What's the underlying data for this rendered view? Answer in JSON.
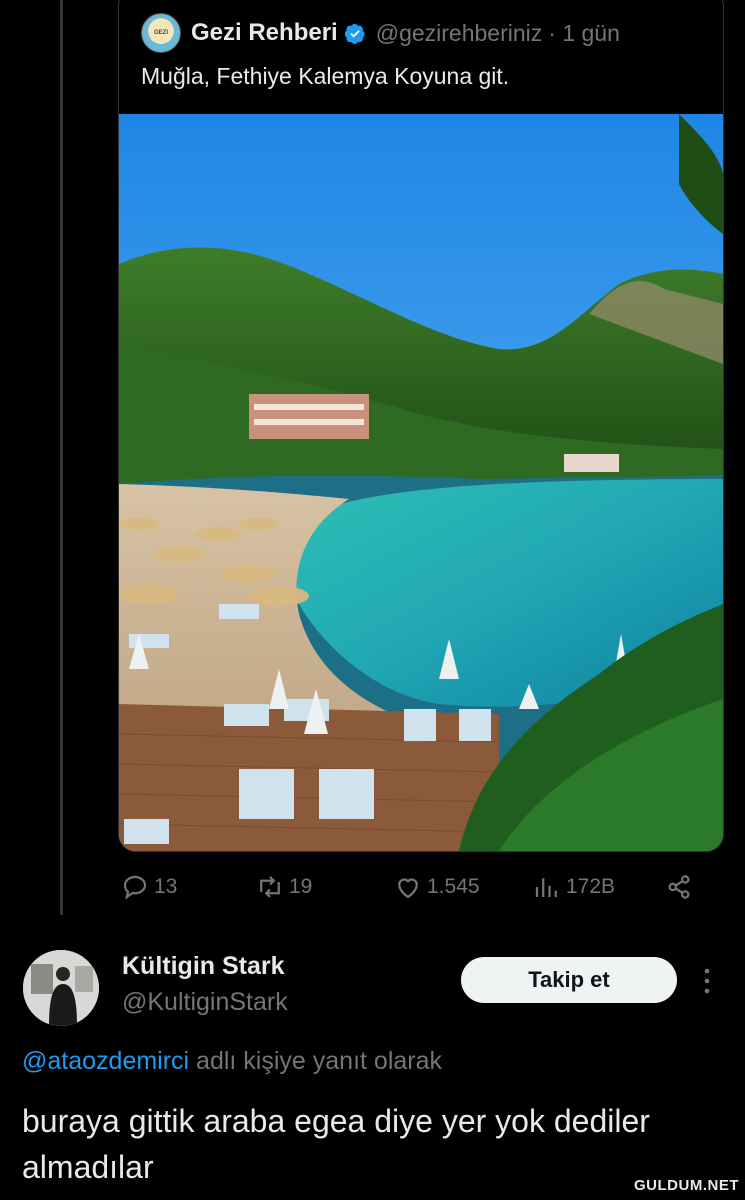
{
  "quoted_tweet": {
    "author_name": "Gezi Rehberi",
    "handle": "@gezirehberiniz",
    "time": "· 1 gün",
    "text": "Muğla, Fethiye Kalemya Koyuna git.",
    "avatar_icon": "globe-logo-icon",
    "verified_icon": "verified-badge-icon",
    "photo_subject": "beach-cove-photo"
  },
  "actions": {
    "replies": "13",
    "retweets": "19",
    "likes": "1.545",
    "views": "172B",
    "icons": [
      "reply-icon",
      "retweet-icon",
      "like-icon",
      "views-icon",
      "share-icon"
    ]
  },
  "reply": {
    "author_name": "Kültigin Stark",
    "handle": "@KultiginStark",
    "follow_label": "Takip et",
    "reply_to_mention": "@ataozdemirci",
    "reply_to_suffix": " adlı kişiye yanıt olarak",
    "text": "buraya gittik araba egea diye yer yok dediler almadılar"
  },
  "watermark": "GULDUM.NET",
  "colors": {
    "background": "#000000",
    "text_primary": "#e7e9ea",
    "text_secondary": "#71767b",
    "accent": "#1d9bf0",
    "follow_button_bg": "#eff3f4"
  }
}
